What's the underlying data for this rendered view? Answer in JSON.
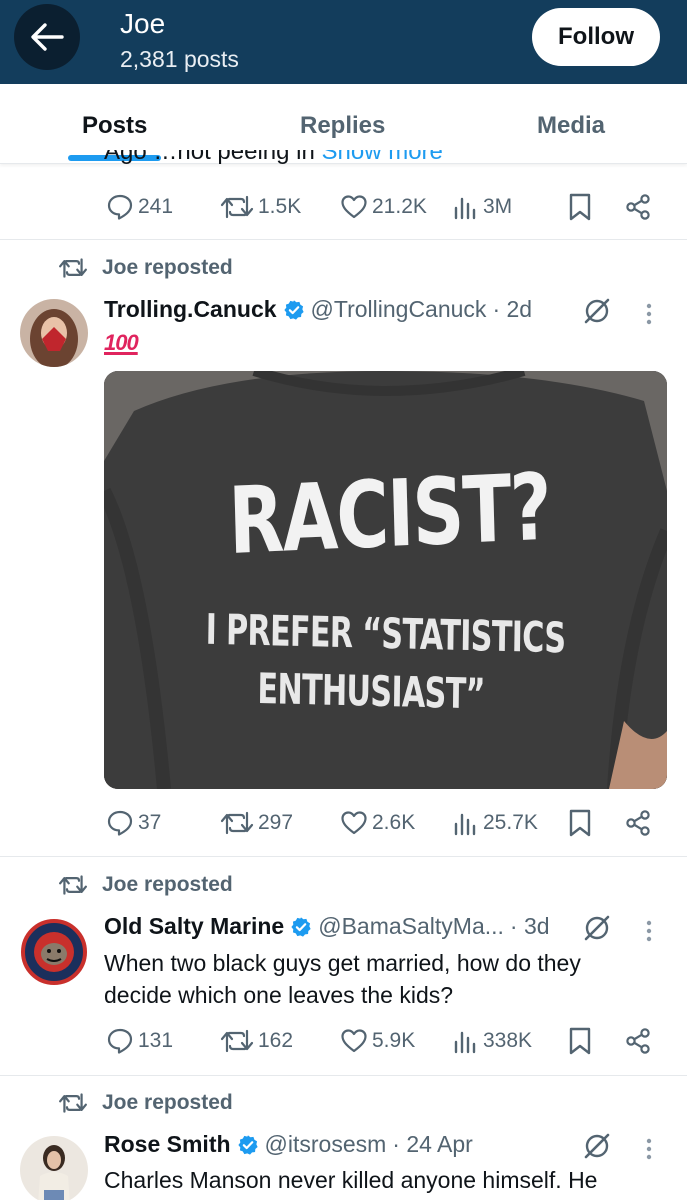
{
  "header": {
    "name": "Joe",
    "post_count": "2,381 posts",
    "follow_label": "Follow",
    "bg_color": "#133d5c"
  },
  "tabs": [
    {
      "label": "Posts",
      "active": true
    },
    {
      "label": "Replies",
      "active": false
    },
    {
      "label": "Media",
      "active": false
    }
  ],
  "top_post": {
    "cut_text": "Ago …not peeing in",
    "show_more": "Show more",
    "replies": "241",
    "reposts": "1.5K",
    "likes": "21.2K",
    "views": "3M"
  },
  "posts": [
    {
      "repost_label": "Joe reposted",
      "author_name": "Trolling.Canuck",
      "handle": "@TrollingCanuck",
      "time": "· 2d",
      "text": "",
      "emoji": "100",
      "image": {
        "line1": "RACIST?",
        "line2": "I PREFER “STATISTICS",
        "line3": "ENTHUSIAST”"
      },
      "replies": "37",
      "reposts": "297",
      "likes": "2.6K",
      "views": "25.7K"
    },
    {
      "repost_label": "Joe reposted",
      "author_name": "Old Salty Marine",
      "handle": "@BamaSaltyMa...",
      "time": "· 3d",
      "text": "When two black guys get married, how do they decide which one leaves the kids?",
      "avatar_text_top": "GRUMPY OLD",
      "avatar_text_bottom": "MARINE",
      "replies": "131",
      "reposts": "162",
      "likes": "5.9K",
      "views": "338K"
    },
    {
      "repost_label": "Joe reposted",
      "author_name": "Rose Smith",
      "handle": "@itsrosesm",
      "time": "· 24 Apr",
      "text": "Charles Manson never killed anyone himself. He"
    }
  ],
  "colors": {
    "accent": "#1d9bf0",
    "muted": "#536471",
    "text": "#0f1419"
  }
}
